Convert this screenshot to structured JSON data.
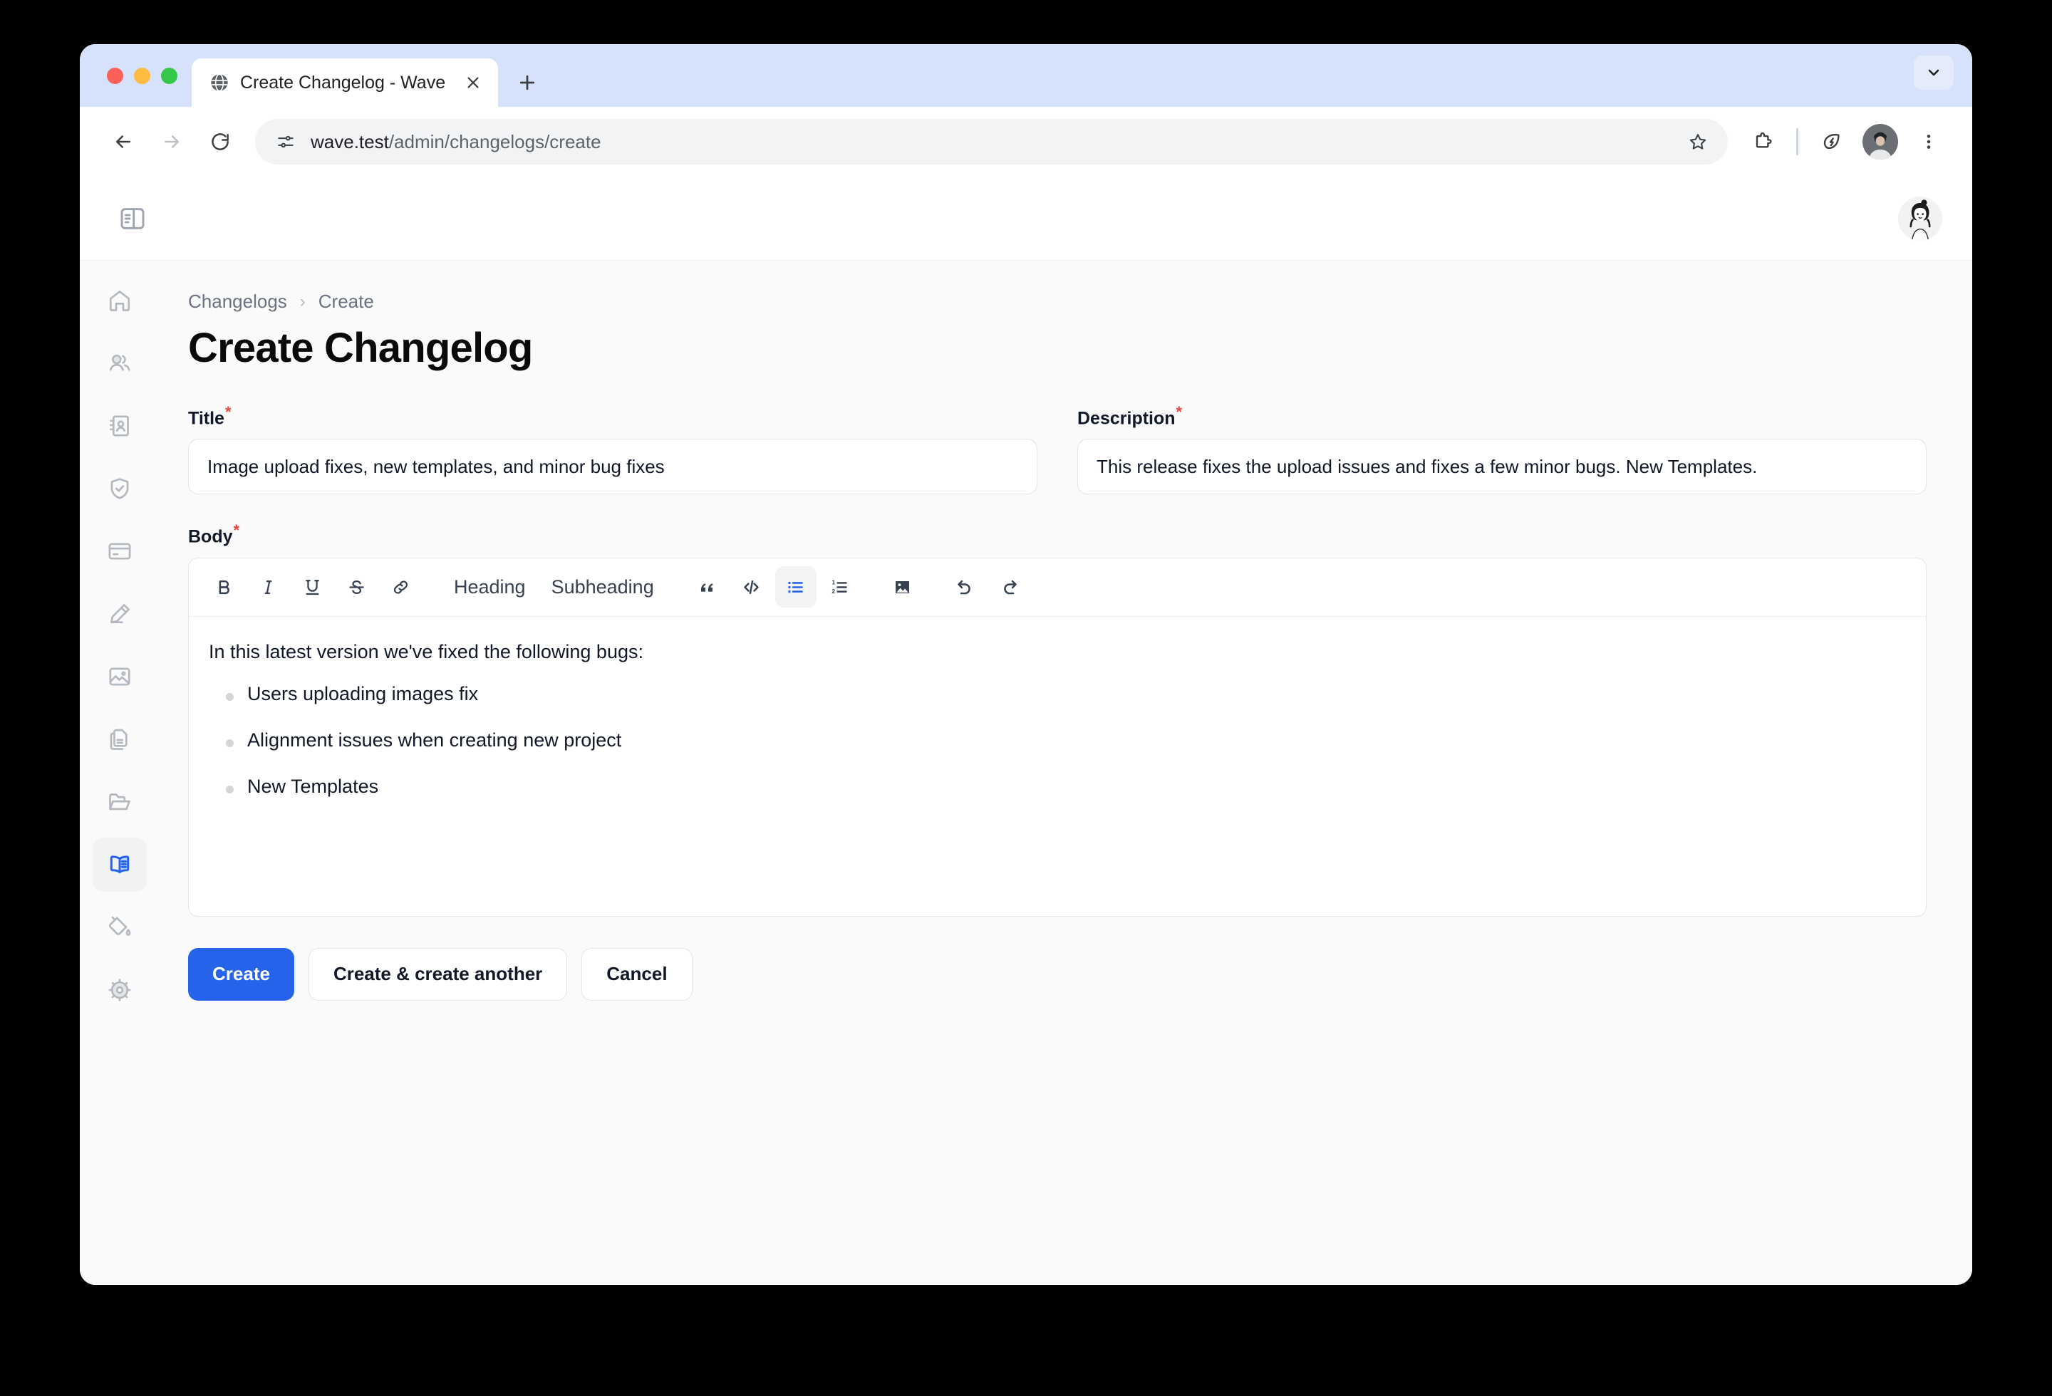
{
  "browser": {
    "tab": {
      "title": "Create Changelog - Wave",
      "favicon_icon": "globe-icon",
      "close_icon": "close-icon"
    },
    "new_tab_icon": "plus-icon",
    "tab_search_icon": "chevron-down-icon",
    "nav": {
      "back_icon": "arrow-left-icon",
      "forward_icon": "arrow-right-icon",
      "reload_icon": "reload-icon"
    },
    "omnibox": {
      "site_info_icon": "site-settings-icon",
      "url_host": "wave.test",
      "url_path": "/admin/changelogs/create",
      "bookmark_icon": "star-icon"
    },
    "toolbar": {
      "extensions_icon": "puzzle-icon",
      "energy_saver_icon": "leaf-icon",
      "profile_icon": "profile-avatar",
      "menu_icon": "three-dot-menu-icon"
    }
  },
  "app": {
    "header": {
      "sidebar_toggle_icon": "sidebar-toggle-icon",
      "user_avatar_icon": "user-avatar"
    },
    "sidebar": {
      "items": [
        {
          "name": "home",
          "icon": "home-icon",
          "active": false
        },
        {
          "name": "users",
          "icon": "users-icon",
          "active": false
        },
        {
          "name": "contacts",
          "icon": "contact-book-icon",
          "active": false
        },
        {
          "name": "roles",
          "icon": "shield-check-icon",
          "active": false
        },
        {
          "name": "billing",
          "icon": "credit-card-icon",
          "active": false
        },
        {
          "name": "posts",
          "icon": "pencil-icon",
          "active": false
        },
        {
          "name": "media",
          "icon": "image-icon",
          "active": false
        },
        {
          "name": "pages",
          "icon": "documents-icon",
          "active": false
        },
        {
          "name": "files",
          "icon": "folder-icon",
          "active": false
        },
        {
          "name": "changelogs",
          "icon": "open-book-icon",
          "active": true
        },
        {
          "name": "theme",
          "icon": "paint-bucket-icon",
          "active": false
        },
        {
          "name": "settings",
          "icon": "gear-icon",
          "active": false
        }
      ]
    },
    "breadcrumb": {
      "parent": "Changelogs",
      "separator": "›",
      "current": "Create"
    },
    "page_title": "Create Changelog",
    "form": {
      "title_field": {
        "label": "Title",
        "required_mark": "*",
        "value": "Image upload fixes, new templates, and minor bug fixes"
      },
      "description_field": {
        "label": "Description",
        "required_mark": "*",
        "value": "This release fixes the upload issues and fixes a few minor bugs. New Templates."
      },
      "body_field": {
        "label": "Body",
        "required_mark": "*",
        "toolbar": [
          {
            "name": "bold",
            "label": "B",
            "icon": "bold-icon",
            "active": false
          },
          {
            "name": "italic",
            "label": "I",
            "icon": "italic-icon",
            "active": false
          },
          {
            "name": "underline",
            "label": "U",
            "icon": "underline-icon",
            "active": false
          },
          {
            "name": "strikethrough",
            "label": "S",
            "icon": "strikethrough-icon",
            "active": false
          },
          {
            "name": "link",
            "label": "",
            "icon": "link-icon",
            "active": false
          },
          {
            "name": "heading",
            "label": "Heading",
            "icon": "heading-text",
            "active": false
          },
          {
            "name": "subheading",
            "label": "Subheading",
            "icon": "subheading-text",
            "active": false
          },
          {
            "name": "blockquote",
            "label": "",
            "icon": "quote-icon",
            "active": false
          },
          {
            "name": "code",
            "label": "",
            "icon": "code-icon",
            "active": false
          },
          {
            "name": "bullet-list",
            "label": "",
            "icon": "bullet-list-icon",
            "active": true
          },
          {
            "name": "numbered-list",
            "label": "",
            "icon": "numbered-list-icon",
            "active": false
          },
          {
            "name": "image",
            "label": "",
            "icon": "image-icon",
            "active": false
          },
          {
            "name": "undo",
            "label": "",
            "icon": "undo-icon",
            "active": false
          },
          {
            "name": "redo",
            "label": "",
            "icon": "redo-icon",
            "active": false
          }
        ],
        "paragraph": "In this latest version we've fixed the following bugs:",
        "list_items": [
          "Users uploading images fix",
          "Alignment issues when creating new project",
          "New Templates"
        ]
      },
      "actions": {
        "create": "Create",
        "create_another": "Create & create another",
        "cancel": "Cancel"
      }
    }
  },
  "colors": {
    "accent": "#2563eb",
    "required": "#ef4444",
    "tabstrip": "#d6e2fb",
    "page_bg": "#fafafa"
  }
}
